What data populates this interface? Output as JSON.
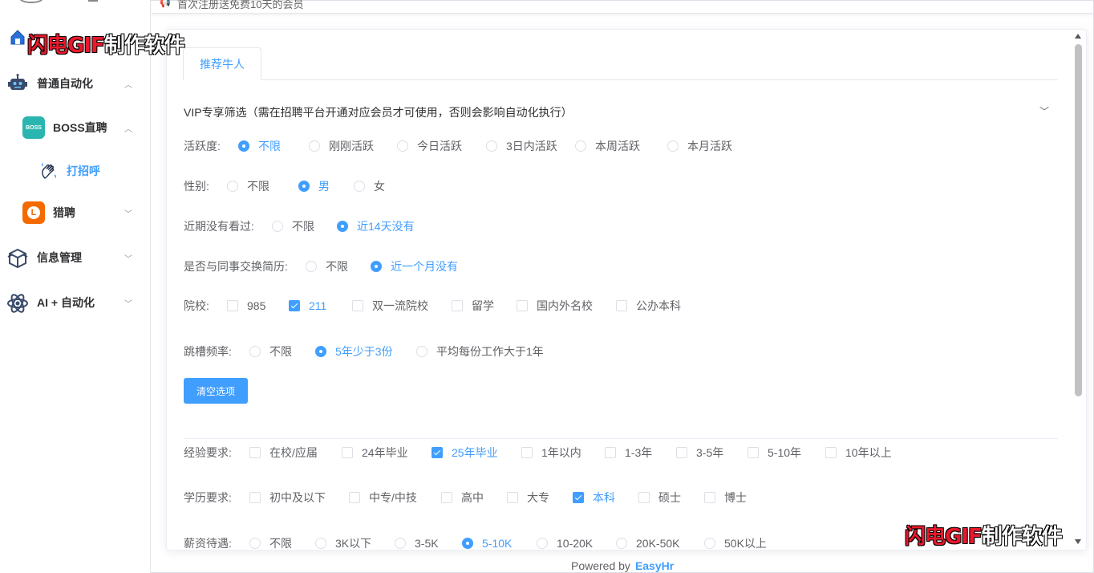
{
  "watermark": {
    "red": "闪电GIF",
    "white": "制作软件"
  },
  "sidebar": {
    "items": [
      {
        "label": "普通自动化",
        "icon": "robot-icon"
      },
      {
        "label": "BOSS直聘",
        "icon": "boss-logo-icon",
        "badge": "BOSS"
      },
      {
        "label": "打招呼",
        "icon": "waving-hand-icon"
      },
      {
        "label": "猎聘",
        "icon": "liepin-logo-icon",
        "badge": "L"
      },
      {
        "label": "信息管理",
        "icon": "box-icon"
      },
      {
        "label": "AI + 自动化",
        "icon": "atom-icon"
      }
    ]
  },
  "notice": {
    "text": "首次注册送免费10天的会员"
  },
  "tabs": [
    {
      "label": "推荐牛人"
    }
  ],
  "vip": {
    "title": "VIP专享筛选（需在招聘平台开通对应会员才可使用，否则会影响自动化执行）"
  },
  "filters": {
    "activity": {
      "label": "活跃度:",
      "options": [
        "不限",
        "刚刚活跃",
        "今日活跃",
        "3日内活跃",
        "本周活跃",
        "本月活跃"
      ],
      "selected": "不限"
    },
    "gender": {
      "label": "性别:",
      "options": [
        "不限",
        "男",
        "女"
      ],
      "selected": "男"
    },
    "recent_viewed": {
      "label": "近期没有看过:",
      "options": [
        "不限",
        "近14天没有"
      ],
      "selected": "近14天没有"
    },
    "exchange_resume": {
      "label": "是否与同事交换简历:",
      "options": [
        "不限",
        "近一个月没有"
      ],
      "selected": "近一个月没有"
    },
    "school": {
      "label": "院校:",
      "options": [
        "985",
        "211",
        "双一流院校",
        "留学",
        "国内外名校",
        "公办本科"
      ],
      "checked": [
        "211"
      ]
    },
    "job_hopping": {
      "label": "跳槽频率:",
      "options": [
        "不限",
        "5年少于3份",
        "平均每份工作大于1年"
      ],
      "selected": "5年少于3份"
    },
    "clear_button": "清空选项",
    "experience": {
      "label": "经验要求:",
      "options": [
        "在校/应届",
        "24年毕业",
        "25年毕业",
        "1年以内",
        "1-3年",
        "3-5年",
        "5-10年",
        "10年以上"
      ],
      "checked": [
        "25年毕业"
      ]
    },
    "education": {
      "label": "学历要求:",
      "options": [
        "初中及以下",
        "中专/中技",
        "高中",
        "大专",
        "本科",
        "硕士",
        "博士"
      ],
      "checked": [
        "本科"
      ]
    },
    "salary": {
      "label": "薪资待遇:",
      "options": [
        "不限",
        "3K以下",
        "3-5K",
        "5-10K",
        "10-20K",
        "20K-50K",
        "50K以上"
      ],
      "selected": "5-10K"
    }
  },
  "footer": {
    "prefix": "Powered by",
    "brand": "EasyHr"
  },
  "colors": {
    "accent": "#409eff",
    "text": "#606266",
    "boss_teal": "#2bb5b0",
    "liepin_orange": "#f56a00"
  }
}
